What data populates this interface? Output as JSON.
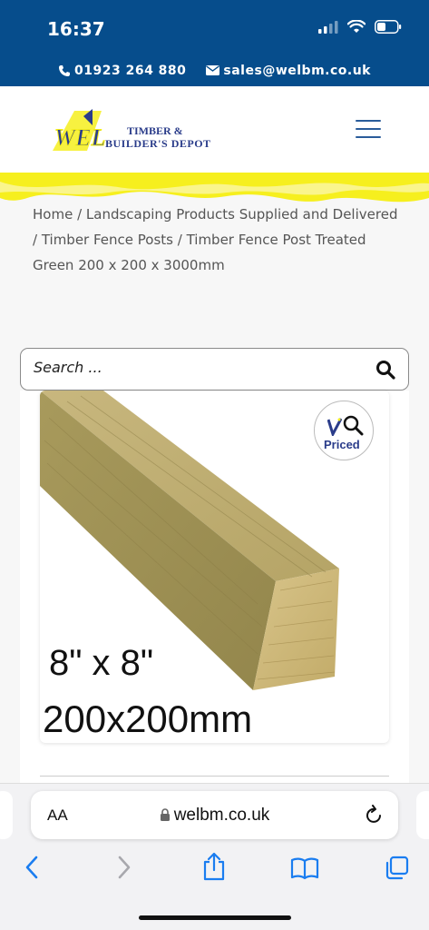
{
  "status_bar": {
    "time": "16:37"
  },
  "contact_bar": {
    "phone": "01923 264 880",
    "email": "sales@welbm.co.uk"
  },
  "header": {
    "logo_mark": "WEL",
    "logo_line1": "TIMBER &",
    "logo_line2": "BUILDER'S DEPOT"
  },
  "breadcrumb": {
    "home": "Home",
    "sep": " / ",
    "cat1": "Landscaping Products Supplied and Delivered",
    "cat2": "Timber Fence Posts",
    "current": "Timber Fence Post Treated Green 200 x 200 x 3000mm"
  },
  "search": {
    "placeholder": "Search ..."
  },
  "product": {
    "dim_inches": "8\" x 8\"",
    "dim_mm": "200x200mm",
    "badge_text": "Priced"
  },
  "browser": {
    "aa": "AA",
    "url": "welbm.co.uk"
  },
  "colors": {
    "brand_blue": "#064d8c",
    "accent_yellow": "#f6ef1e"
  }
}
